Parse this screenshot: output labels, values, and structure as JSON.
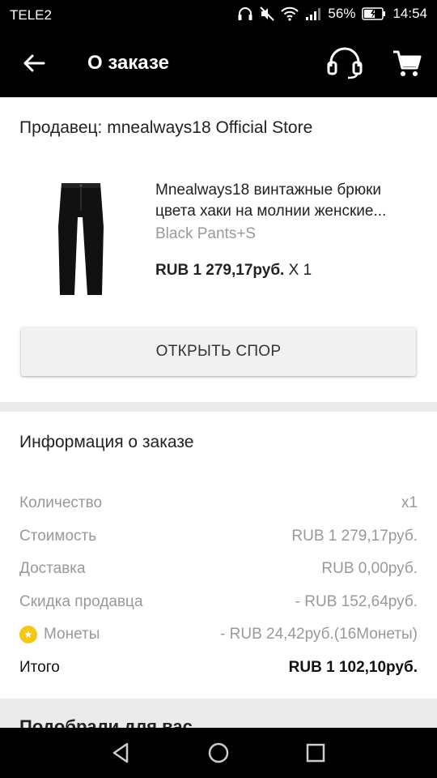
{
  "status_bar": {
    "carrier": "TELE2",
    "battery": "56%",
    "time": "14:54"
  },
  "app_bar": {
    "title": "О заказе"
  },
  "order": {
    "seller": "Продавец: mnealways18 Official Store",
    "product_title_line1": "Mnealways18 винтажные брюки",
    "product_title_line2": "цвета хаки на молнии женские...",
    "variant": "Black Pants+S",
    "price": "RUB 1 279,17руб.",
    "quantity": " X 1",
    "dispute_button": "ОТКРЫТЬ СПОР"
  },
  "info": {
    "title": "Информация о заказе",
    "rows": [
      {
        "label": "Количество",
        "value": "x1"
      },
      {
        "label": "Стоимость",
        "value": "RUB 1 279,17руб."
      },
      {
        "label": "Доставка",
        "value": "RUB 0,00руб."
      },
      {
        "label": "Скидка продавца",
        "value": "- RUB 152,64руб."
      },
      {
        "label": "Монеты",
        "value": "- RUB 24,42руб.(16Монеты)"
      }
    ],
    "total_label": "Итого",
    "total_value": "RUB 1 102,10руб."
  },
  "recommend": {
    "title": "Подобрали для вас"
  },
  "colors": {
    "bar": "#000000",
    "coin": "#f5c518",
    "muted_text": "#999999"
  }
}
